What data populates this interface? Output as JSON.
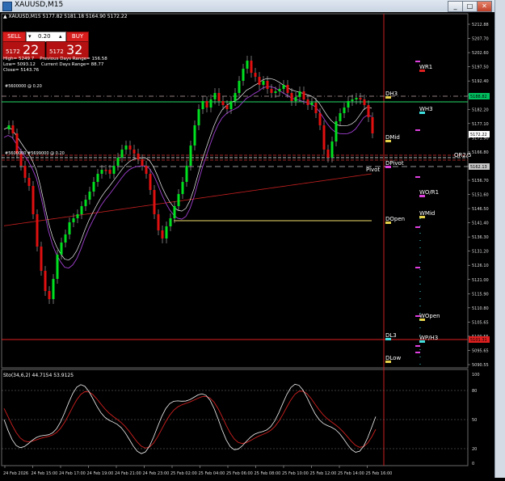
{
  "window": {
    "title": "XAUUSD,M15",
    "minimize": "_",
    "restore": "□",
    "close": "✕"
  },
  "header": {
    "info_line": "▲ XAUUSD,M15  5177.82 5181.18 5164.90 5172.22"
  },
  "trade_panel": {
    "sell_label": "SELL",
    "buy_label": "BUY",
    "lot": "0.20",
    "minus": "▾",
    "plus": "▴",
    "sell_small": "5172",
    "sell_big": "22",
    "buy_small": "5172",
    "buy_big": "32"
  },
  "info_panel": {
    "line1": "High= 5249.7    Previous Days Range= 156.58",
    "line2": "Low= 5093.12    Current Days Range= 88.77",
    "line3": "Close= 5143.76"
  },
  "price_axis": {
    "ticks": [
      "5212.88",
      "5207.70",
      "5202.60",
      "5197.50",
      "5192.40",
      "5187.30",
      "5182.20",
      "5177.10",
      "5171.90",
      "5166.80",
      "5161.70",
      "5156.70",
      "5151.60",
      "5146.50",
      "5141.40",
      "5136.30",
      "5131.20",
      "5126.10",
      "5121.00",
      "5115.90",
      "5110.80",
      "5105.65",
      "5100.55",
      "5095.65",
      "5090.55"
    ],
    "markers": [
      {
        "label": "5188.82",
        "color": "#00c060"
      },
      {
        "label": "5172.22",
        "color": "#ffffff"
      },
      {
        "label": "5162.13",
        "color": "#c7c7c7"
      },
      {
        "label": "5101.31",
        "color": "#e02020"
      }
    ]
  },
  "levels": [
    {
      "label": "DH3",
      "color": "#ffffff",
      "marker": "#e8d24a"
    },
    {
      "label": "DMid",
      "color": "#ffffff",
      "marker": "#e8d24a"
    },
    {
      "label": "DPivot",
      "color": "#ffffff",
      "marker": "#e040e0"
    },
    {
      "label": "Pivot",
      "color": "#ffffff",
      "marker": ""
    },
    {
      "label": "DOpen",
      "color": "#ffffff",
      "marker": "#e8d24a"
    },
    {
      "label": "DL3",
      "color": "#ffffff",
      "marker": "#40e0e0"
    },
    {
      "label": "DLow",
      "color": "#ffffff",
      "marker": "#e8d24a"
    },
    {
      "label": "WR1",
      "color": "#ffffff",
      "marker": "#e02020"
    },
    {
      "label": "WH3",
      "color": "#ffffff",
      "marker": "#40e0e0"
    },
    {
      "label": "WO/R1",
      "color": "#ffffff",
      "marker": "#e040e0"
    },
    {
      "label": "WMid",
      "color": "#ffffff",
      "marker": "#e8d24a"
    },
    {
      "label": "WOpen",
      "color": "#ffffff",
      "marker": "#e8d24a"
    },
    {
      "label": "WP/H3",
      "color": "#ffffff",
      "marker": "#40e0e0"
    },
    {
      "label": "QR2/5",
      "color": "#ffffff",
      "marker": ""
    }
  ],
  "chart_text": {
    "level_tag_top": "#5600000 @ 0.20",
    "level_tag_mid": "#5600000 #5699000 @ 0.20"
  },
  "stochastic": {
    "label": "Sto(34,6,2) 44.7154 53.9125",
    "ticks": [
      "100",
      "80",
      "50",
      "20",
      "0"
    ]
  },
  "time_axis": {
    "labels": [
      "24 Feb 2026",
      "24 Feb 15:00",
      "24 Feb 17:00",
      "24 Feb 19:00",
      "24 Feb 21:00",
      "24 Feb 23:00",
      "25 Feb 02:00",
      "25 Feb 04:00",
      "25 Feb 06:00",
      "25 Feb 08:00",
      "25 Feb 10:00",
      "25 Feb 12:00",
      "25 Feb 14:00",
      "25 Feb 16:00"
    ]
  }
}
